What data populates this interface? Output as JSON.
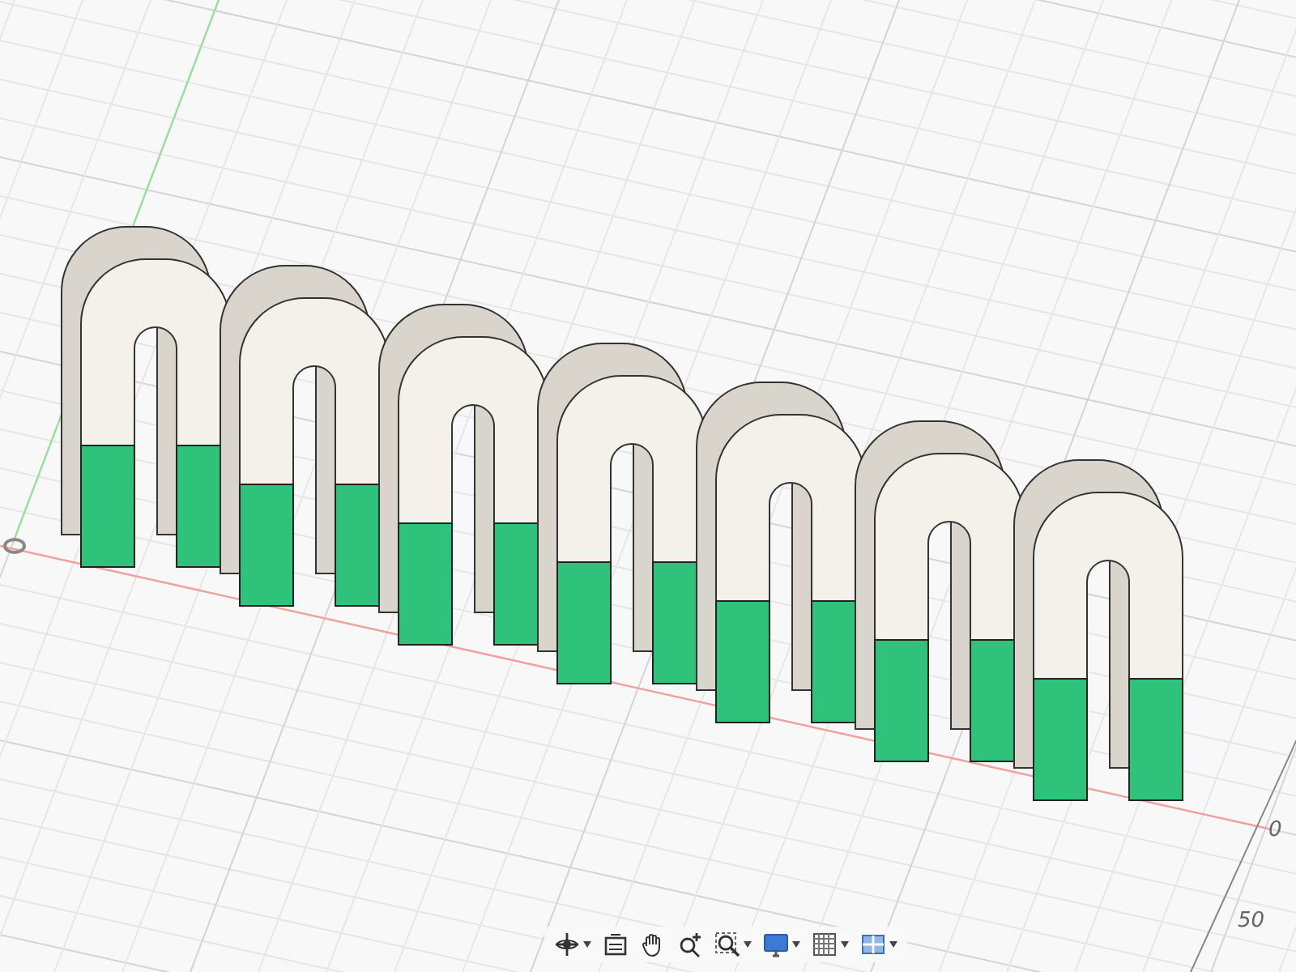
{
  "viewport": {
    "ruler_labels": [
      {
        "text": "0",
        "kind": "origin"
      },
      {
        "text": "50",
        "kind": "tick"
      }
    ]
  },
  "toolbar": {
    "buttons": [
      {
        "kind": "orbit",
        "dropdown": true
      },
      {
        "kind": "look-at",
        "dropdown": false
      },
      {
        "kind": "pan",
        "dropdown": false
      },
      {
        "kind": "zoom",
        "dropdown": false
      },
      {
        "kind": "fit",
        "dropdown": true
      },
      {
        "kind": "display",
        "dropdown": true
      },
      {
        "kind": "grid",
        "dropdown": true
      },
      {
        "kind": "viewports",
        "dropdown": true
      }
    ]
  }
}
